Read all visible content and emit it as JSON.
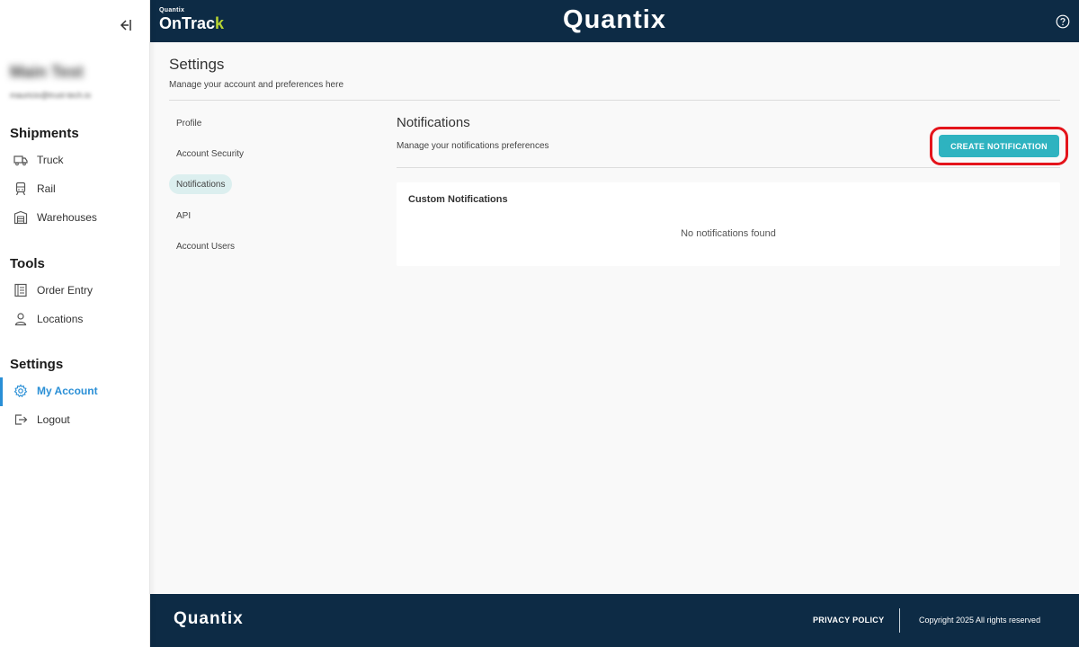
{
  "sidebar": {
    "collapse_icon": "collapse-left-icon",
    "user": {
      "name": "Main Test",
      "email": "mauricio@trust-tech.io"
    },
    "sections": [
      {
        "title": "Shipments",
        "items": [
          {
            "label": "Truck",
            "icon": "truck-icon"
          },
          {
            "label": "Rail",
            "icon": "train-icon"
          },
          {
            "label": "Warehouses",
            "icon": "warehouse-icon"
          }
        ]
      },
      {
        "title": "Tools",
        "items": [
          {
            "label": "Order Entry",
            "icon": "order-list-icon"
          },
          {
            "label": "Locations",
            "icon": "person-location-icon"
          }
        ]
      },
      {
        "title": "Settings",
        "items": [
          {
            "label": "My Account",
            "icon": "gear-icon",
            "active": true
          },
          {
            "label": "Logout",
            "icon": "logout-icon"
          }
        ]
      }
    ]
  },
  "header": {
    "brand_small_top": "Quantix",
    "brand_small_main": "OnTrac",
    "brand_small_accent": "k",
    "brand_center": "Quantix",
    "help_icon": "help-circle-icon"
  },
  "settings": {
    "title": "Settings",
    "subtitle": "Manage your account and preferences here",
    "nav": [
      {
        "label": "Profile"
      },
      {
        "label": "Account Security"
      },
      {
        "label": "Notifications",
        "active": true
      },
      {
        "label": "API"
      },
      {
        "label": "Account Users"
      }
    ]
  },
  "notifications": {
    "title": "Notifications",
    "subtitle": "Manage your notifications preferences",
    "create_button": "CREATE NOTIFICATION",
    "card_title": "Custom Notifications",
    "empty_text": "No notifications found"
  },
  "footer": {
    "brand": "Quantix",
    "privacy": "PRIVACY POLICY",
    "copyright": "Copyright 2025 All rights reserved"
  },
  "colors": {
    "header_bg": "#0d2b45",
    "accent_teal": "#2eb3c0",
    "active_blue": "#2a8fd6",
    "brand_green": "#b7d433",
    "highlight_red": "#e4141b"
  }
}
